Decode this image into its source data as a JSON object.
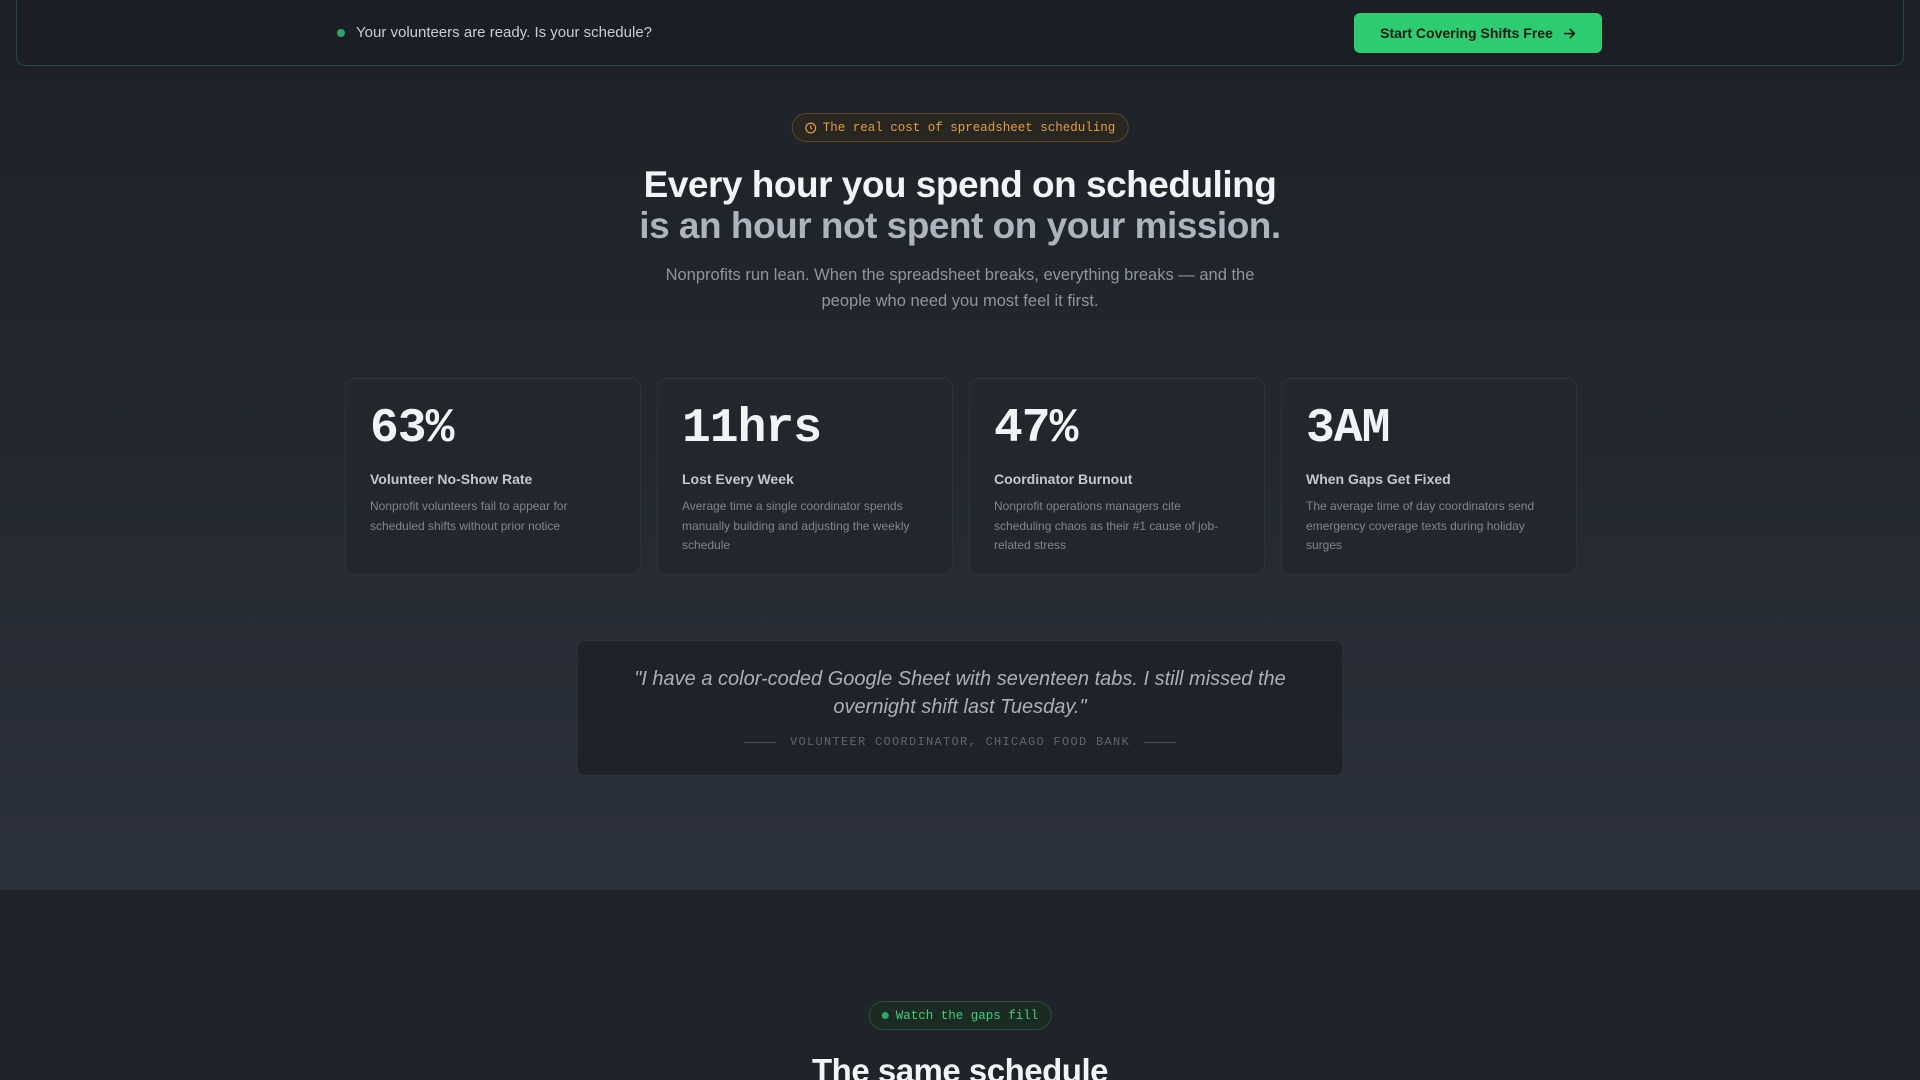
{
  "topbar": {
    "message": "Your volunteers are ready. Is your schedule?",
    "cta_label": "Start Covering Shifts Free",
    "cta_icon": "arrow-right-icon",
    "accent_color": "#2ecc71"
  },
  "hero": {
    "badge": "The real cost of spreadsheet scheduling",
    "badge_icon": "clock-icon",
    "headline_line1": "Every hour you spend on scheduling",
    "headline_line2": "is an hour not spent on your mission.",
    "subtitle": "Nonprofits run lean. When the spreadsheet breaks, everything breaks — and the people who need you most feel it first."
  },
  "stats": [
    {
      "value": "63%",
      "label": "Volunteer No-Show Rate",
      "desc": "Nonprofit volunteers fail to appear for scheduled shifts without prior notice"
    },
    {
      "value": "11hrs",
      "label": "Lost Every Week",
      "desc": "Average time a single coordinator spends manually building and adjusting the weekly schedule"
    },
    {
      "value": "47%",
      "label": "Coordinator Burnout",
      "desc": "Nonprofit operations managers cite scheduling chaos as their #1 cause of job-related stress"
    },
    {
      "value": "3AM",
      "label": "When Gaps Get Fixed",
      "desc": "The average time of day coordinators send emergency coverage texts during holiday surges"
    }
  ],
  "quote": {
    "text": "\"I have a color-coded Google Sheet with seventeen tabs. I still missed the overnight shift last Tuesday.\"",
    "attribution": "VOLUNTEER COORDINATOR, CHICAGO FOOD BANK"
  },
  "section2": {
    "badge": "Watch the gaps fill",
    "title": "The same schedule"
  }
}
